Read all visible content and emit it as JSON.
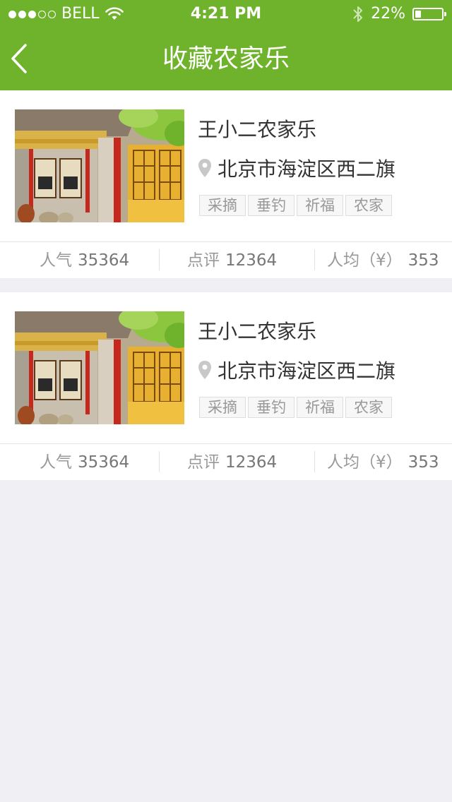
{
  "status_bar": {
    "carrier": "BELL",
    "time": "4:21 PM",
    "battery": "22%",
    "battery_level": 0.22
  },
  "nav": {
    "title": "收藏农家乐"
  },
  "colors": {
    "brand": "#6fb22b",
    "background": "#efeff4"
  },
  "favorites": [
    {
      "name": "王小二农家乐",
      "address": "北京市海淀区西二旗",
      "tags": [
        "采摘",
        "垂钓",
        "祈福",
        "农家"
      ],
      "popularity_label": "人气",
      "popularity": "35364",
      "reviews_label": "点评",
      "reviews": "12364",
      "avg_price_label": "人均（¥）",
      "avg_price": "353"
    },
    {
      "name": "王小二农家乐",
      "address": "北京市海淀区西二旗",
      "tags": [
        "采摘",
        "垂钓",
        "祈福",
        "农家"
      ],
      "popularity_label": "人气",
      "popularity": "35364",
      "reviews_label": "点评",
      "reviews": "12364",
      "avg_price_label": "人均（¥）",
      "avg_price": "353"
    }
  ]
}
